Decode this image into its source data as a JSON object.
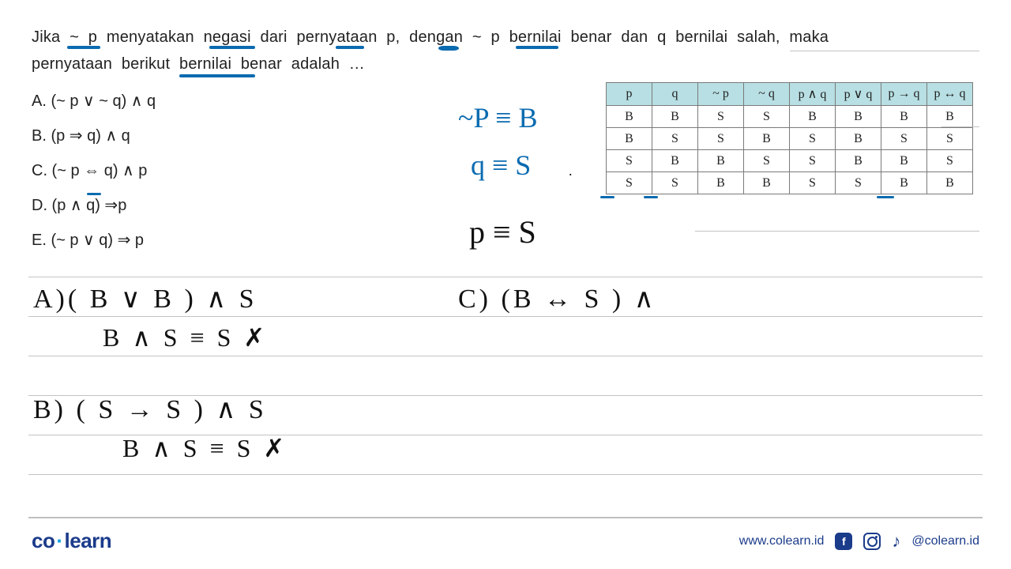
{
  "question": {
    "line1_parts": [
      "Jika",
      "~ p",
      "menyatakan",
      "negasi",
      "dari",
      "pernyataan",
      "p,",
      "dengan",
      "~ p",
      "bernilai",
      "benar",
      "dan",
      "q",
      "bernilai",
      "salah,",
      "maka"
    ],
    "line2": "pernyataan berikut bernilai benar adalah …"
  },
  "options": {
    "A": "A. (~ p ∨ ~ q) ∧ q",
    "B": "B. (p ⇒ q) ∧ q",
    "C": "C. (~ p ⇔ q) ∧ p",
    "D": "D. (p ∧ q) ⇒p",
    "E": "E. (~ p ∨ q) ⇒ p"
  },
  "truth_table": {
    "headers": [
      "p",
      "q",
      "~ p",
      "~ q",
      "p ∧ q",
      "p ∨ q",
      "p → q",
      "p ↔ q"
    ],
    "rows": [
      [
        "B",
        "B",
        "S",
        "S",
        "B",
        "B",
        "B",
        "B"
      ],
      [
        "B",
        "S",
        "S",
        "B",
        "S",
        "B",
        "S",
        "S"
      ],
      [
        "S",
        "B",
        "B",
        "S",
        "S",
        "B",
        "B",
        "S"
      ],
      [
        "S",
        "S",
        "B",
        "B",
        "S",
        "S",
        "B",
        "B"
      ]
    ]
  },
  "hand": {
    "notP": "~P ≡ B",
    "q": "q ≡ S",
    "p": "p ≡ S",
    "A_expr1": "A)( B ∨ B ) ∧ S",
    "A_expr2": "B   ∧ S  ≡  S    ✗",
    "B_expr1": "B) ( S → S ) ∧ S",
    "B_expr2": "B  ∧ S  ≡  S  ✗",
    "C_expr": "C)  (B ↔ S ) ∧"
  },
  "footer": {
    "logo_co": "co",
    "logo_learn": "learn",
    "url": "www.colearn.id",
    "handle": "@colearn.id"
  }
}
